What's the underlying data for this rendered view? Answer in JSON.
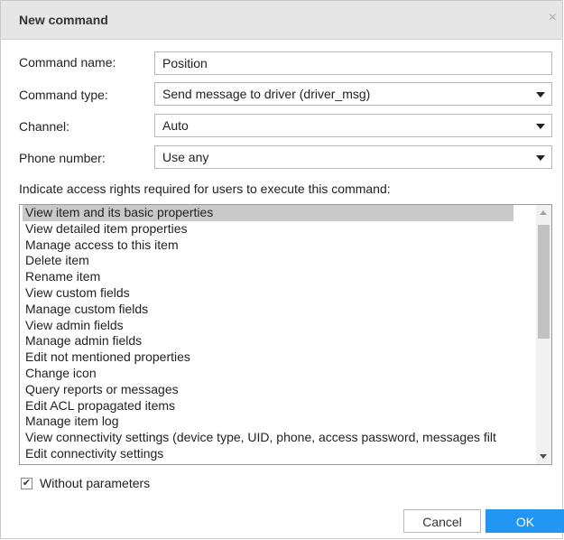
{
  "dialog": {
    "title": "New command",
    "close_glyph": "×"
  },
  "form": {
    "command_name": {
      "label": "Command name:",
      "value": "Position"
    },
    "command_type": {
      "label": "Command type:",
      "value": "Send message to driver (driver_msg)"
    },
    "channel": {
      "label": "Channel:",
      "value": "Auto"
    },
    "phone_number": {
      "label": "Phone number:",
      "value": "Use any"
    }
  },
  "access": {
    "hint": "Indicate access rights required for users to execute this command:",
    "items": [
      {
        "label": "View item and its basic properties",
        "selected": true
      },
      {
        "label": "View detailed item properties",
        "selected": false
      },
      {
        "label": "Manage access to this item",
        "selected": false
      },
      {
        "label": "Delete item",
        "selected": false
      },
      {
        "label": "Rename item",
        "selected": false
      },
      {
        "label": "View custom fields",
        "selected": false
      },
      {
        "label": "Manage custom fields",
        "selected": false
      },
      {
        "label": "View admin fields",
        "selected": false
      },
      {
        "label": "Manage admin fields",
        "selected": false
      },
      {
        "label": "Edit not mentioned properties",
        "selected": false
      },
      {
        "label": "Change icon",
        "selected": false
      },
      {
        "label": "Query reports or messages",
        "selected": false
      },
      {
        "label": "Edit ACL propagated items",
        "selected": false
      },
      {
        "label": "Manage item log",
        "selected": false
      },
      {
        "label": "View connectivity settings (device type, UID, phone, access password, messages filt",
        "selected": false
      },
      {
        "label": "Edit connectivity settings",
        "selected": false
      }
    ]
  },
  "options": {
    "without_parameters": {
      "label": "Without parameters",
      "checked": true,
      "check_glyph": "✔"
    }
  },
  "buttons": {
    "cancel": "Cancel",
    "ok": "OK"
  },
  "colors": {
    "ok_button": "#2196f3",
    "selected_row": "#c9c9c9",
    "titlebar": "#e6e6e6"
  },
  "icons": {
    "close": "close-icon",
    "dropdown": "chevron-down-icon",
    "check": "checkmark-icon"
  }
}
